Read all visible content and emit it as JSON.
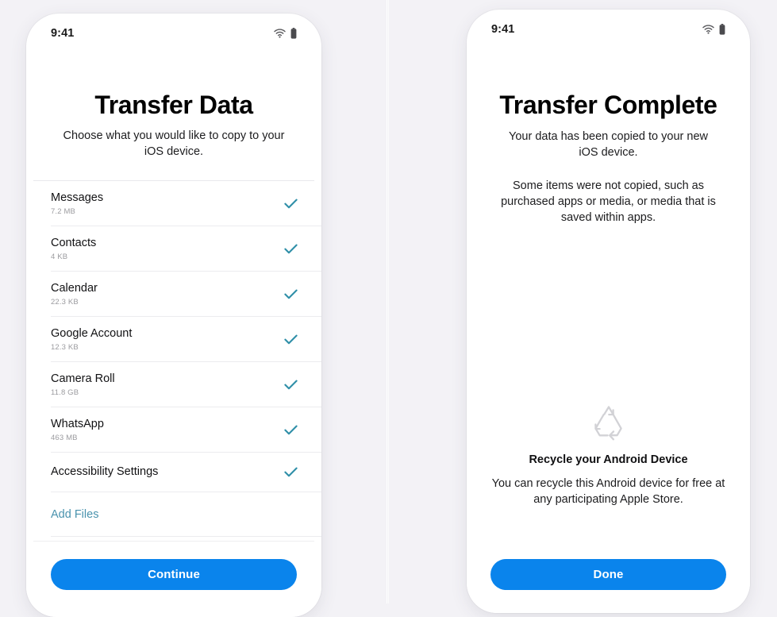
{
  "theme": {
    "page_background": "#f3f2f6",
    "accent_blue": "#0a84ec",
    "check_teal": "#2f8fa8",
    "link_blue": "#4a93ae",
    "recycle_gray": "#d2d2d6"
  },
  "screens": [
    {
      "id": "transfer-data",
      "status_bar": {
        "time": "9:41",
        "wifi_icon": "wifi-icon",
        "battery_icon": "battery-full-icon"
      },
      "title": "Transfer Data",
      "subtitle": "Choose what you would like to copy to your iOS device.",
      "items": [
        {
          "label": "Messages",
          "size": "7.2 MB",
          "checked": true,
          "check_icon": "check-icon"
        },
        {
          "label": "Contacts",
          "size": "4 KB",
          "checked": true,
          "check_icon": "check-icon"
        },
        {
          "label": "Calendar",
          "size": "22.3 KB",
          "checked": true,
          "check_icon": "check-icon"
        },
        {
          "label": "Google Account",
          "size": "12.3 KB",
          "checked": true,
          "check_icon": "check-icon"
        },
        {
          "label": "Camera Roll",
          "size": "11.8 GB",
          "checked": true,
          "check_icon": "check-icon"
        },
        {
          "label": "WhatsApp",
          "size": "463 MB",
          "checked": true,
          "check_icon": "check-icon"
        },
        {
          "label": "Accessibility Settings",
          "size": "",
          "checked": true,
          "check_icon": "check-icon"
        }
      ],
      "add_files_label": "Add Files",
      "cta_label": "Continue"
    },
    {
      "id": "transfer-complete",
      "status_bar": {
        "time": "9:41",
        "wifi_icon": "wifi-icon",
        "battery_icon": "battery-full-icon"
      },
      "title": "Transfer Complete",
      "subtitle": "Your data has been copied to your new iOS device.",
      "note": "Some items were not copied, such as purchased apps or media, or media that is saved within apps.",
      "recycle": {
        "icon": "recycle-icon",
        "title": "Recycle your Android Device",
        "body": "You can recycle this Android device for free at any participating Apple Store."
      },
      "cta_label": "Done"
    }
  ]
}
